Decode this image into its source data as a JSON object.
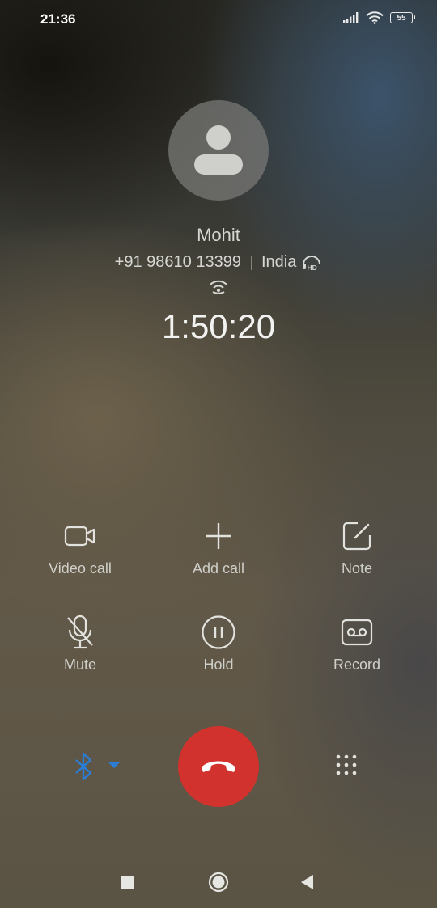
{
  "status_bar": {
    "time": "21:36",
    "battery": "55",
    "icons": [
      "signal-icon",
      "wifi-icon",
      "battery-icon"
    ]
  },
  "caller": {
    "name": "Mohit",
    "number": "+91 98610 13399",
    "location": "India",
    "duration": "1:50:20"
  },
  "actions": {
    "video_call": "Video call",
    "add_call": "Add call",
    "note": "Note",
    "mute": "Mute",
    "hold": "Hold",
    "record": "Record"
  },
  "colors": {
    "end_call": "#d2322e",
    "bluetooth": "#2a7ed8",
    "text": "#cfcfca"
  }
}
